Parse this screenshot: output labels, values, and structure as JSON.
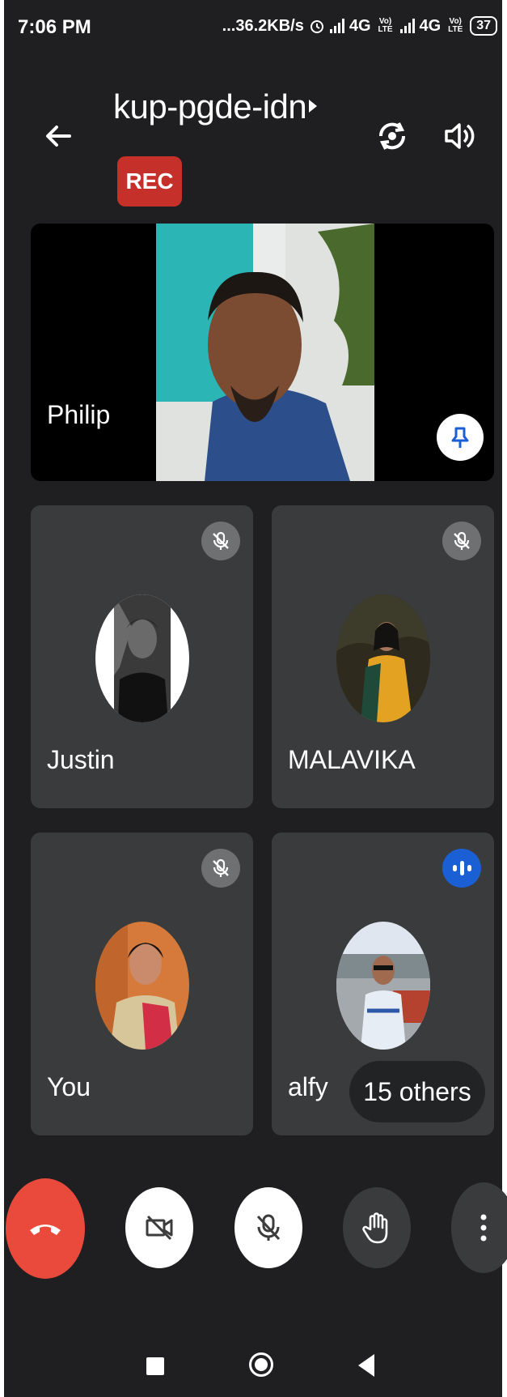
{
  "status_bar": {
    "time": "7:06 PM",
    "network_speed": "...36.2KB/s",
    "network_1": "4G",
    "network_2": "4G",
    "lte_label": "Vo) LTE",
    "battery": "37"
  },
  "header": {
    "title": "kup-pgde-idn",
    "rec_label": "REC"
  },
  "participants": {
    "main": {
      "name": "Philip"
    },
    "tiles": [
      {
        "name": "Justin"
      },
      {
        "name": "MALAVIKA"
      },
      {
        "name": "You"
      },
      {
        "name": "alfy"
      }
    ],
    "others_label": "15 others"
  },
  "icons": {
    "back": "arrow-left-icon",
    "camera_switch": "camera-switch-icon",
    "speaker": "speaker-icon",
    "pin": "pin-icon",
    "mic_off": "mic-off-icon",
    "speaking": "speaking-indicator-icon",
    "end_call": "phone-hangup-icon",
    "camera_off": "video-off-icon",
    "raise_hand": "hand-icon",
    "more": "more-vertical-icon"
  },
  "colors": {
    "background": "#1f1f21",
    "tile": "#3a3b3d",
    "rec": "#c5302b",
    "end_call": "#e94a3c",
    "accent": "#1a5fd4"
  }
}
